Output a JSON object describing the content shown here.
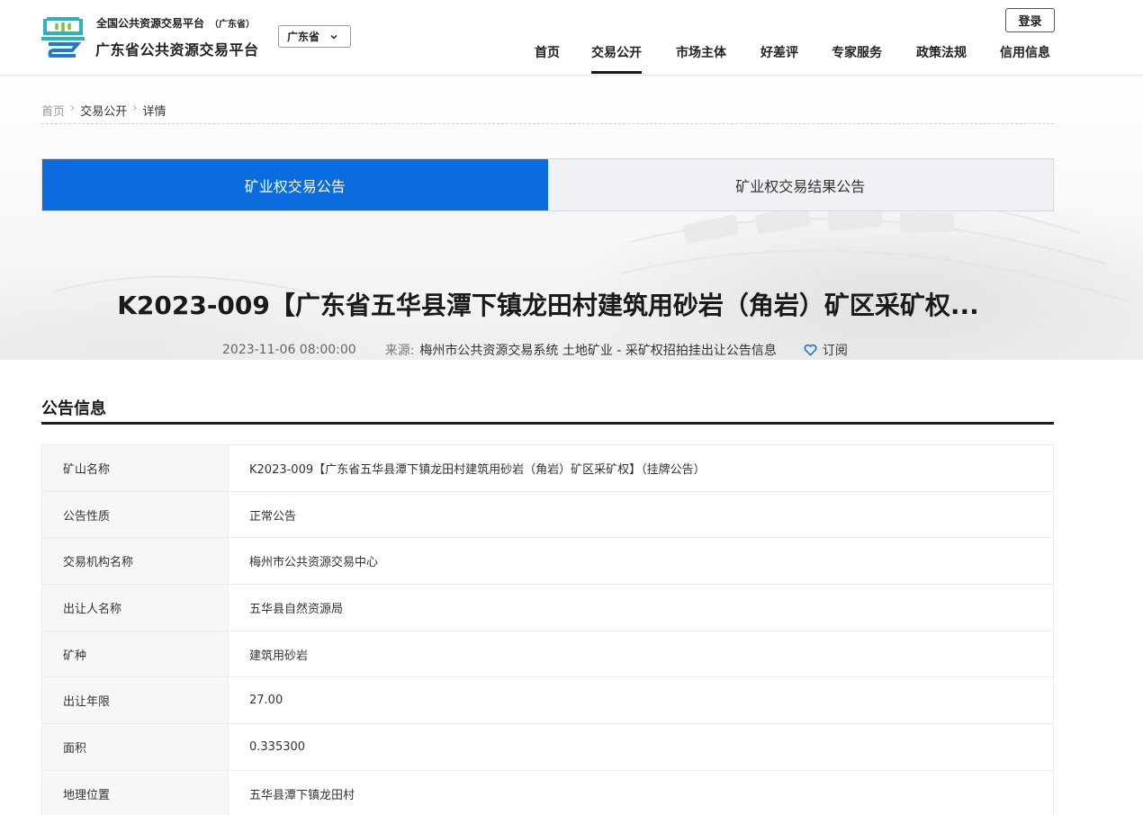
{
  "header": {
    "brand_top": "全国公共资源交易平台",
    "brand_top_sub": "（广东省）",
    "brand_main": "广东省公共资源交易平台",
    "region": "广东省",
    "login": "登录",
    "nav": [
      {
        "label": "首页",
        "active": false
      },
      {
        "label": "交易公开",
        "active": true
      },
      {
        "label": "市场主体",
        "active": false
      },
      {
        "label": "好差评",
        "active": false
      },
      {
        "label": "专家服务",
        "active": false
      },
      {
        "label": "政策法规",
        "active": false
      },
      {
        "label": "信用信息",
        "active": false
      }
    ]
  },
  "breadcrumb": [
    "首页",
    "交易公开",
    "详情"
  ],
  "tabs": [
    {
      "label": "矿业权交易公告",
      "active": true
    },
    {
      "label": "矿业权交易结果公告",
      "active": false
    }
  ],
  "article": {
    "title": "K2023-009【广东省五华县潭下镇龙田村建筑用砂岩（角岩）矿区采矿权...",
    "datetime": "2023-11-06 08:00:00",
    "source_label": "来源:",
    "source": "梅州市公共资源交易系统 土地矿业 - 采矿权招拍挂出让公告信息",
    "subscribe": "订阅"
  },
  "section_title": "公告信息",
  "info_rows": [
    {
      "key": "矿山名称",
      "value": "K2023-009【广东省五华县潭下镇龙田村建筑用砂岩（角岩）矿区采矿权】（挂牌公告）"
    },
    {
      "key": "公告性质",
      "value": "正常公告"
    },
    {
      "key": "交易机构名称",
      "value": "梅州市公共资源交易中心"
    },
    {
      "key": "出让人名称",
      "value": "五华县自然资源局"
    },
    {
      "key": "矿种",
      "value": "建筑用砂岩"
    },
    {
      "key": "出让年限",
      "value": "27.00"
    },
    {
      "key": "面积",
      "value": "0.335300"
    },
    {
      "key": "地理位置",
      "value": "五华县潭下镇龙田村"
    }
  ],
  "colors": {
    "accent": "#0a6cdf",
    "logo_teal": "#2bb3c0",
    "logo_green": "#7cc243",
    "logo_blue": "#1f7bd0"
  }
}
